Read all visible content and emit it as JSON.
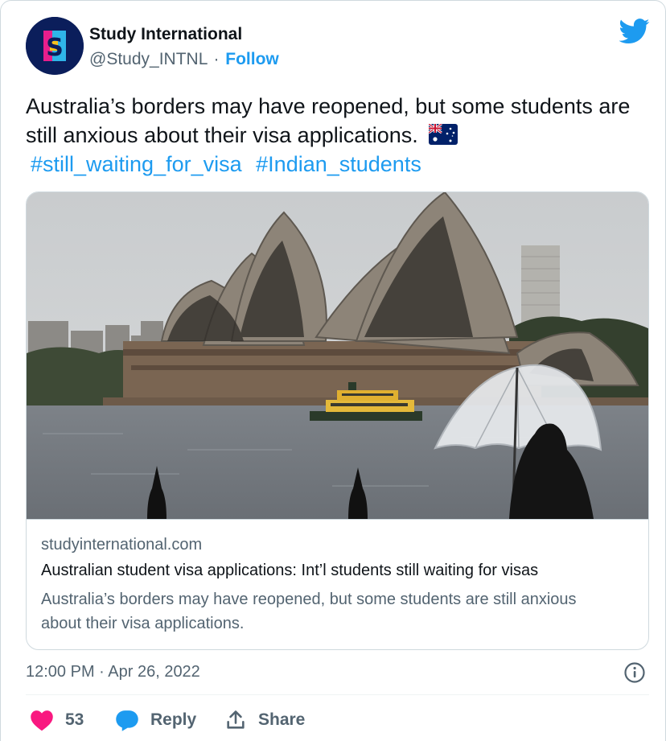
{
  "author": {
    "name": "Study International",
    "handle": "@Study_INTNL",
    "separator": "·",
    "follow_label": "Follow",
    "avatar_letter": "S"
  },
  "tweet": {
    "text": "Australia’s borders may have reopened, but some students are still anxious about their visa applications.",
    "flag_icon": "australia-flag-emoji",
    "hashtags": [
      "#still_waiting_for_visa",
      "#Indian_students"
    ]
  },
  "link_card": {
    "domain": "studyinternational.com",
    "title": "Australian student visa applications: Int’l students still waiting for visas",
    "description": "Australia’s borders may have reopened, but some students are still anxious about their visa applications."
  },
  "timestamp": "12:00 PM · Apr 26, 2022",
  "actions": {
    "like_count": "53",
    "reply_label": "Reply",
    "share_label": "Share"
  },
  "colors": {
    "accent": "#1d9bf0",
    "like": "#f91880",
    "muted": "#536471"
  }
}
